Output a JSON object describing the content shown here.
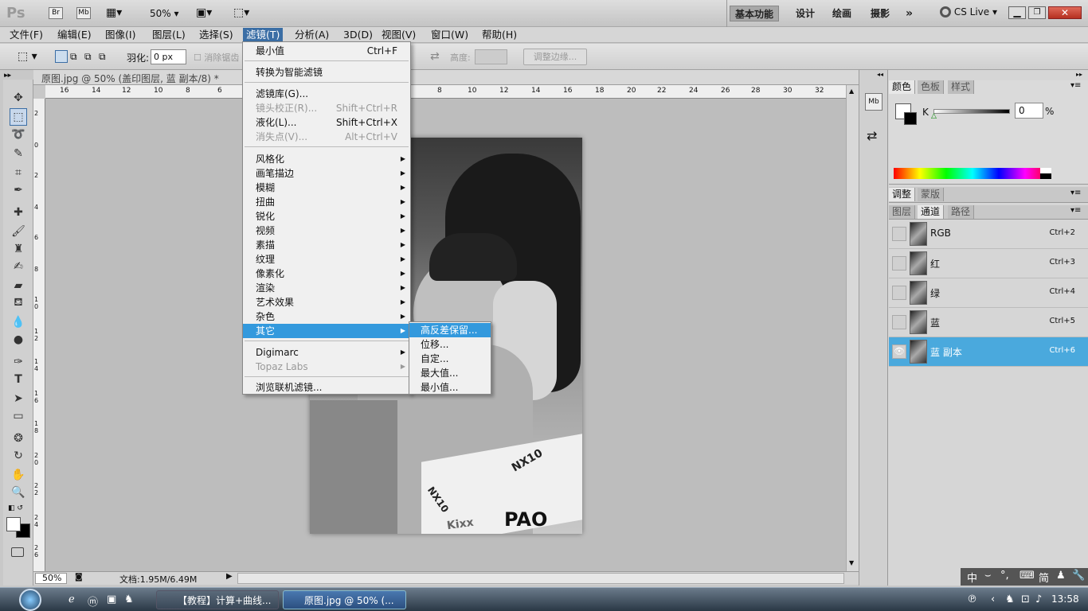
{
  "app": {
    "logo": "Ps",
    "zoom": "50%",
    "workspaces": [
      "基本功能",
      "设计",
      "绘画",
      "摄影"
    ],
    "more": "»",
    "cs_live": "CS Live"
  },
  "menubar": [
    "文件(F)",
    "编辑(E)",
    "图像(I)",
    "图层(L)",
    "选择(S)",
    "滤镜(T)",
    "分析(A)",
    "3D(D)",
    "视图(V)",
    "窗口(W)",
    "帮助(H)"
  ],
  "options": {
    "feather_label": "羽化:",
    "feather_value": "0 px",
    "antialias_label": "消除锯齿",
    "height_label": "高度:",
    "refine_label": "调整边缘..."
  },
  "document": {
    "tab_title": "原图.jpg @ 50% (盖印图层, 蓝 副本/8) *",
    "status_zoom": "50%",
    "status_doc": "文档:1.95M/6.49M",
    "ruler_h_ticks": [
      "16",
      "14",
      "12",
      "10",
      "8",
      "6",
      "8",
      "10",
      "12",
      "14",
      "16",
      "18",
      "20",
      "22",
      "24",
      "26",
      "28",
      "30",
      "32"
    ],
    "ruler_v_ticks": [
      "2",
      "0",
      "2",
      "4",
      "6",
      "8",
      "1 0",
      "1 2",
      "1 4",
      "1 6",
      "1 8",
      "2 0",
      "2 2",
      "2 4",
      "2 6"
    ],
    "photo_text": [
      "NX10",
      "NX10",
      "PAO",
      "Kixx"
    ]
  },
  "filter_menu": {
    "items": [
      {
        "label": "最小值",
        "shortcut": "Ctrl+F"
      },
      {
        "label": "转换为智能滤镜",
        "shortcut": ""
      },
      {
        "label": "滤镜库(G)...",
        "shortcut": ""
      },
      {
        "label": "镜头校正(R)...",
        "shortcut": "Shift+Ctrl+R",
        "disabled": true
      },
      {
        "label": "液化(L)...",
        "shortcut": "Shift+Ctrl+X"
      },
      {
        "label": "消失点(V)...",
        "shortcut": "Alt+Ctrl+V",
        "disabled": true
      },
      {
        "label": "风格化"
      },
      {
        "label": "画笔描边"
      },
      {
        "label": "模糊"
      },
      {
        "label": "扭曲"
      },
      {
        "label": "锐化"
      },
      {
        "label": "视频"
      },
      {
        "label": "素描"
      },
      {
        "label": "纹理"
      },
      {
        "label": "像素化"
      },
      {
        "label": "渲染"
      },
      {
        "label": "艺术效果"
      },
      {
        "label": "杂色"
      },
      {
        "label": "其它"
      },
      {
        "label": "Digimarc"
      },
      {
        "label": "Topaz Labs",
        "disabled": true
      },
      {
        "label": "浏览联机滤镜..."
      }
    ]
  },
  "sub_menu": [
    "高反差保留...",
    "位移...",
    "自定...",
    "最大值...",
    "最小值..."
  ],
  "color_panel": {
    "tabs": [
      "颜色",
      "色板",
      "样式"
    ],
    "channel_label": "K",
    "value": "0",
    "unit": "%"
  },
  "adjust_panel": {
    "tabs": [
      "调整",
      "蒙版"
    ]
  },
  "channels_panel": {
    "tabs": [
      "图层",
      "通道",
      "路径"
    ],
    "rows": [
      {
        "name": "RGB",
        "shortcut": "Ctrl+2"
      },
      {
        "name": "红",
        "shortcut": "Ctrl+3"
      },
      {
        "name": "绿",
        "shortcut": "Ctrl+4"
      },
      {
        "name": "蓝",
        "shortcut": "Ctrl+5"
      },
      {
        "name": "蓝 副本",
        "shortcut": "Ctrl+6"
      }
    ]
  },
  "ime": {
    "items": [
      "中",
      "⌣",
      "°,",
      "⌨",
      "简",
      "♟",
      "🔧"
    ]
  },
  "taskbar": {
    "task1": "【教程】计算+曲线...",
    "task2": "原图.jpg @ 50% (...",
    "clock": "13:58"
  }
}
